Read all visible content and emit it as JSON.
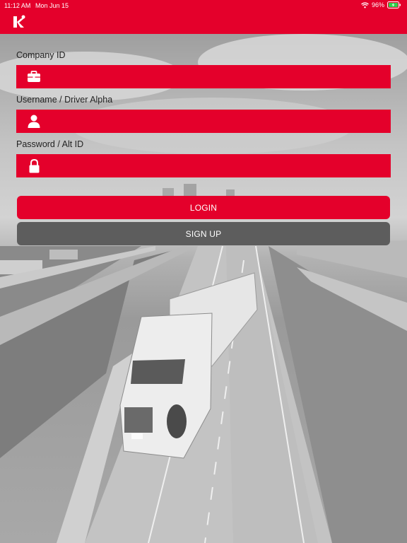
{
  "status_bar": {
    "time": "11:12 AM",
    "date": "Mon Jun 15",
    "battery": "96%",
    "icons": [
      "wifi-icon",
      "battery-charging-icon"
    ]
  },
  "brand": {
    "logo_letter": "k",
    "accent_color": "#e4002b",
    "secondary_button_color": "#5d5d5d"
  },
  "form": {
    "company": {
      "label": "Company ID",
      "value": "",
      "icon": "briefcase-icon"
    },
    "username": {
      "label": "Username / Driver Alpha",
      "value": "",
      "icon": "user-icon"
    },
    "password": {
      "label": "Password / Alt ID",
      "value": "",
      "icon": "lock-icon"
    }
  },
  "buttons": {
    "login": "LOGIN",
    "signup": "SIGN UP"
  }
}
